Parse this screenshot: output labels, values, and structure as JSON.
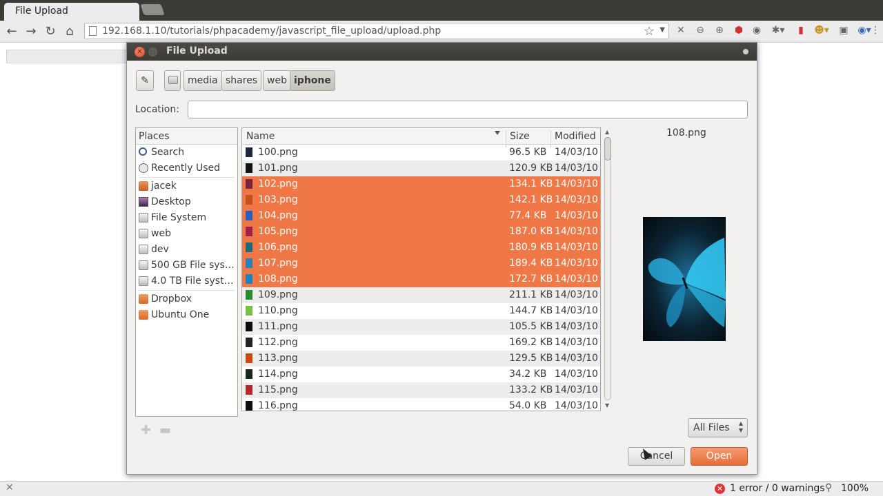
{
  "browser": {
    "tab_title": "File Upload",
    "url": "192.168.1.10/tutorials/phpacademy/javascript_file_upload/upload.php",
    "status": {
      "errors": "1 error / 0 warnings",
      "zoom": "100%"
    }
  },
  "dialog": {
    "title": "File Upload",
    "path_crumbs": [
      "media",
      "shares",
      "web",
      "iphone"
    ],
    "active_crumb": "iphone",
    "location_label": "Location:",
    "location_value": "",
    "places_header": "Places",
    "places": [
      "Search",
      "Recently Used",
      "jacek",
      "Desktop",
      "File System",
      "web",
      "dev",
      "500 GB File syst…",
      "4.0 TB File system",
      "Dropbox",
      "Ubuntu One"
    ],
    "columns": {
      "name": "Name",
      "size": "Size",
      "modified": "Modified"
    },
    "files": [
      {
        "name": "100.png",
        "size": "96.5 KB",
        "modified": "14/03/10",
        "selected": false
      },
      {
        "name": "101.png",
        "size": "120.9 KB",
        "modified": "14/03/10",
        "selected": false
      },
      {
        "name": "102.png",
        "size": "134.1 KB",
        "modified": "14/03/10",
        "selected": true
      },
      {
        "name": "103.png",
        "size": "142.1 KB",
        "modified": "14/03/10",
        "selected": true
      },
      {
        "name": "104.png",
        "size": "77.4 KB",
        "modified": "14/03/10",
        "selected": true
      },
      {
        "name": "105.png",
        "size": "187.0 KB",
        "modified": "14/03/10",
        "selected": true
      },
      {
        "name": "106.png",
        "size": "180.9 KB",
        "modified": "14/03/10",
        "selected": true
      },
      {
        "name": "107.png",
        "size": "189.4 KB",
        "modified": "14/03/10",
        "selected": true
      },
      {
        "name": "108.png",
        "size": "172.7 KB",
        "modified": "14/03/10",
        "selected": true
      },
      {
        "name": "109.png",
        "size": "211.1 KB",
        "modified": "14/03/10",
        "selected": false
      },
      {
        "name": "110.png",
        "size": "144.7 KB",
        "modified": "14/03/10",
        "selected": false
      },
      {
        "name": "111.png",
        "size": "105.5 KB",
        "modified": "14/03/10",
        "selected": false
      },
      {
        "name": "112.png",
        "size": "169.2 KB",
        "modified": "14/03/10",
        "selected": false
      },
      {
        "name": "113.png",
        "size": "129.5 KB",
        "modified": "14/03/10",
        "selected": false
      },
      {
        "name": "114.png",
        "size": "34.2 KB",
        "modified": "14/03/10",
        "selected": false
      },
      {
        "name": "115.png",
        "size": "133.2 KB",
        "modified": "14/03/10",
        "selected": false
      },
      {
        "name": "116.png",
        "size": "54.0 KB",
        "modified": "14/03/10",
        "selected": false
      }
    ],
    "preview_name": "108.png",
    "filter": "All Files",
    "cancel_label": "Cancel",
    "open_label": "Open"
  },
  "colors": {
    "selection": "#f07746",
    "accent": "#dd4814",
    "titlebar": "#3c3b37"
  }
}
